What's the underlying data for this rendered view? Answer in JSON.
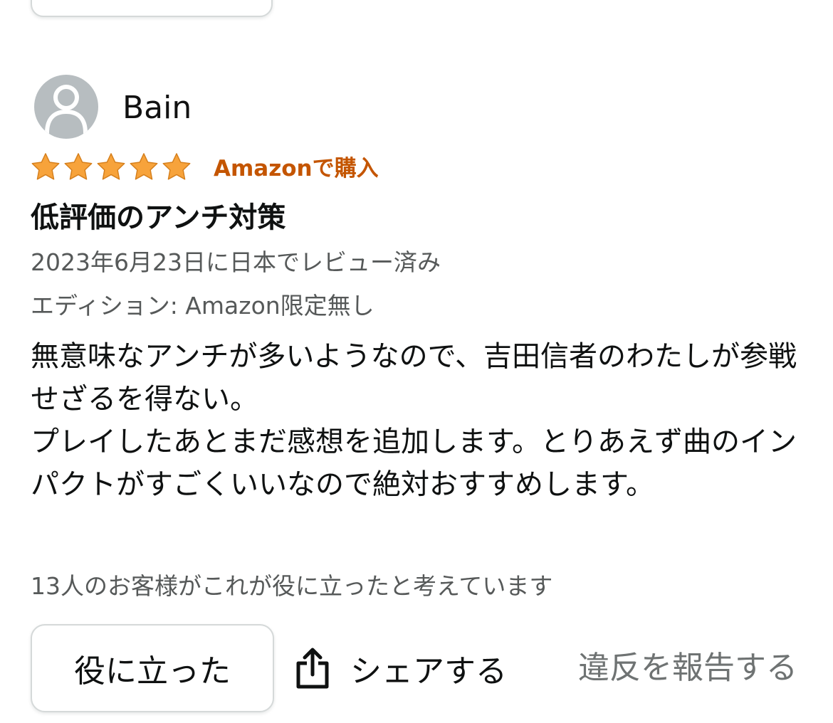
{
  "review": {
    "reviewer_name": "Bain",
    "rating": 5,
    "rating_max": 5,
    "star_color": "#f7a33b",
    "verified_badge": "Amazonで購入",
    "title": "低評価のアンチ対策",
    "date_line": "2023年6月23日に日本でレビュー済み",
    "edition_line": "エディション: Amazon限定無し",
    "body_lines": [
      "無意味なアンチが多いようなので、吉田信者のわたしが参戦せざるを得ない。",
      "プレイしたあとまだ感想を追加します。とりあえず曲のインパクトがすごくいいなので絶対おすすめします。"
    ],
    "helpful_count_text": "13人のお客様がこれが役に立ったと考えています"
  },
  "actions": {
    "helpful_label": "役に立った",
    "share_label": "シェアする",
    "share_icon": "share-icon",
    "report_label": "違反を報告する"
  },
  "colors": {
    "badge": "#c45500",
    "secondary_text": "#565959",
    "report_text": "#6f7373",
    "avatar_bg": "#b7bdc0"
  }
}
